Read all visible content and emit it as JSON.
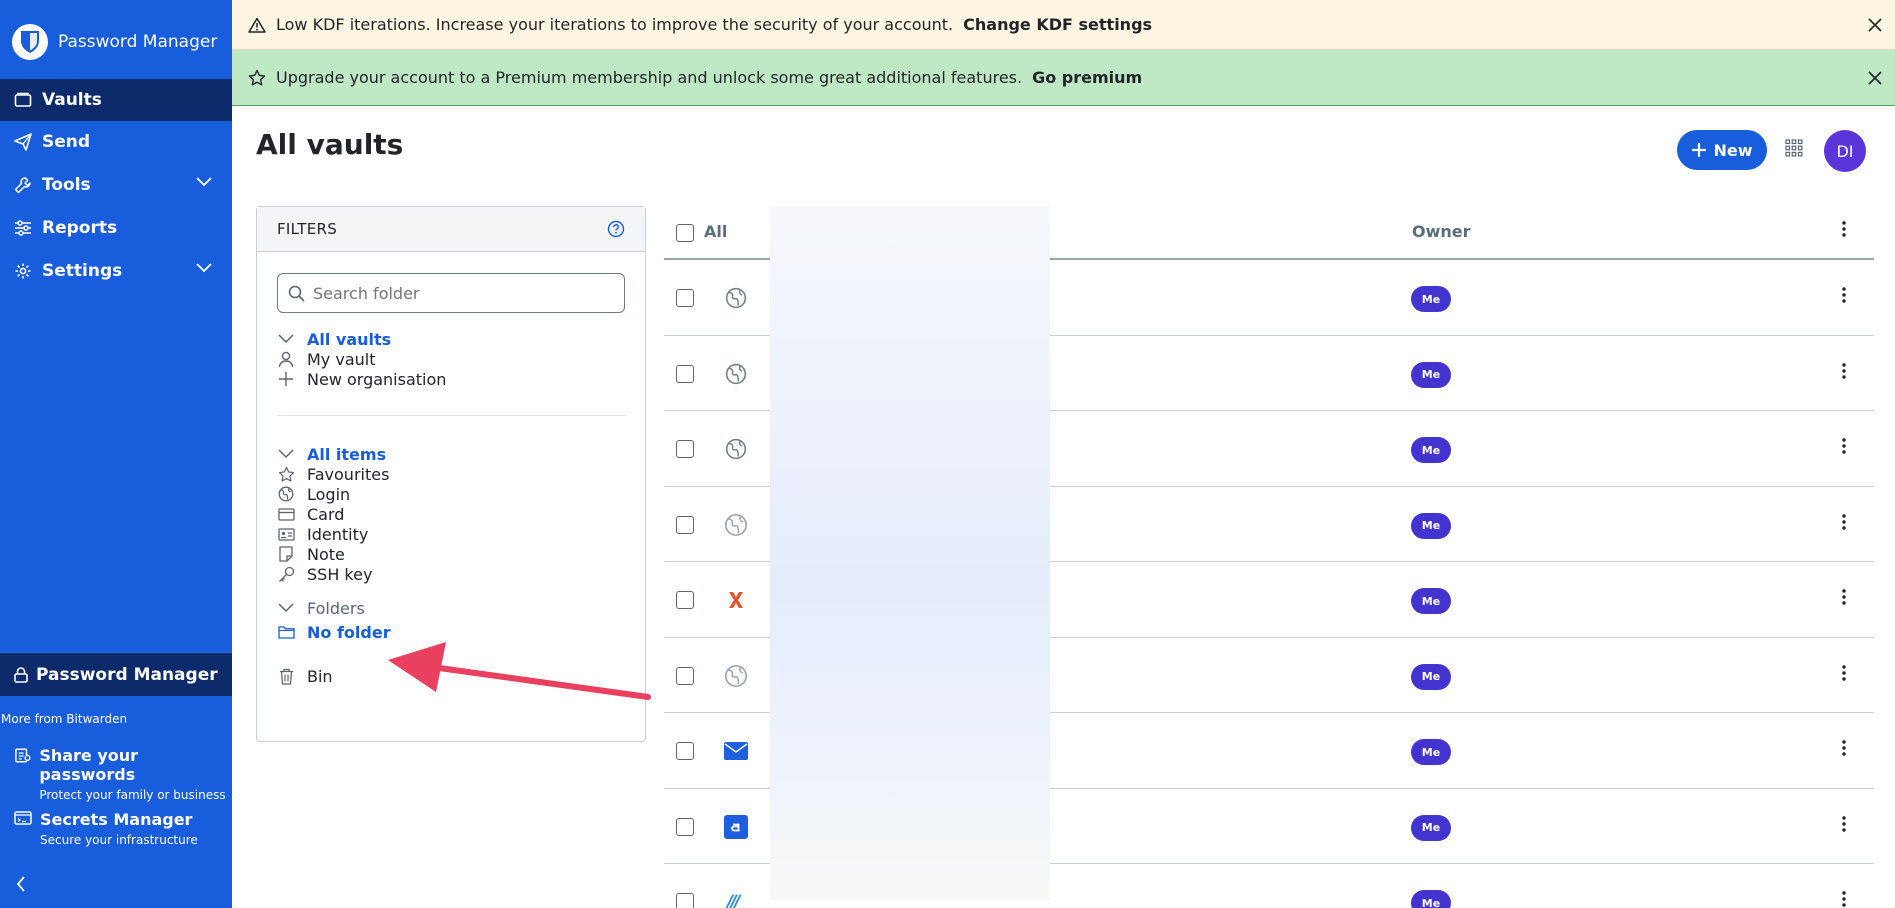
{
  "app": {
    "title": "Password Manager"
  },
  "sidebar": {
    "items": [
      {
        "label": "Vaults",
        "icon": "vault-icon"
      },
      {
        "label": "Send",
        "icon": "send-icon"
      },
      {
        "label": "Tools",
        "icon": "wrench-icon"
      },
      {
        "label": "Reports",
        "icon": "sliders-icon"
      },
      {
        "label": "Settings",
        "icon": "gear-icon"
      }
    ],
    "product_switcher": "Password Manager",
    "more_from": "More from Bitwarden",
    "promos": [
      {
        "title": "Share your passwords",
        "subtitle": "Protect your family or business"
      },
      {
        "title": "Secrets Manager",
        "subtitle": "Secure your infrastructure"
      }
    ]
  },
  "banners": {
    "kdf": {
      "text": "Low KDF iterations. Increase your iterations to improve the security of your account.",
      "link": "Change KDF settings"
    },
    "premium": {
      "text": "Upgrade your account to a Premium membership and unlock some great additional features.",
      "link": "Go premium"
    }
  },
  "header": {
    "title": "All vaults",
    "new_label": "New",
    "avatar_initials": "DI"
  },
  "filters": {
    "title": "FILTERS",
    "search_placeholder": "Search folder",
    "vaults": [
      "All vaults",
      "My vault",
      "New organisation"
    ],
    "types": [
      "All items",
      "Favourites",
      "Login",
      "Card",
      "Identity",
      "Note",
      "SSH key"
    ],
    "folders_label": "Folders",
    "no_folder": "No folder",
    "bin": "Bin"
  },
  "table": {
    "col_all": "All",
    "col_owner": "Owner",
    "rows": [
      {
        "icon": "globe-icon",
        "owner": "Me"
      },
      {
        "icon": "globe-icon",
        "owner": "Me"
      },
      {
        "icon": "globe-icon",
        "owner": "Me"
      },
      {
        "icon": "globe-icon",
        "owner": "Me"
      },
      {
        "icon": "x-logo-icon",
        "owner": "Me"
      },
      {
        "icon": "globe-icon",
        "owner": "Me"
      },
      {
        "icon": "mail-icon",
        "owner": "Me"
      },
      {
        "icon": "app-a-icon",
        "owner": "Me"
      },
      {
        "icon": "stripes-logo-icon",
        "owner": "Me"
      }
    ]
  },
  "colors": {
    "brand": "#175ddc",
    "sidebar_dark": "#0d2b6b",
    "badge": "#4334d0",
    "annotation": "#e8405e"
  }
}
